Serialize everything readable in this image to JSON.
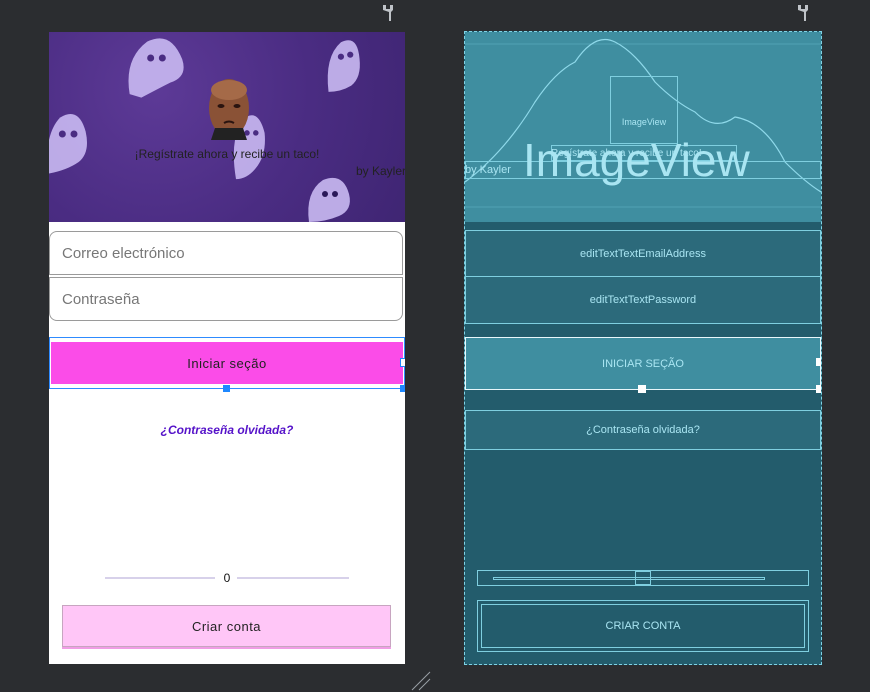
{
  "design": {
    "promo_text": "¡Regístrate ahora y recibe un taco!",
    "byline": "by Kayler",
    "email_placeholder": "Correo electrónico",
    "password_placeholder": "Contraseña",
    "login_label": "Iniciar seção",
    "forgot_label": "¿Contraseña olvidada?",
    "seek_value": "0",
    "create_label": "Criar conta"
  },
  "blueprint": {
    "imageview_small": "ImageView",
    "imageview_big": "ImageView",
    "promo_text": "Regístrate ahora y recibe un taco!",
    "byline": "by Kayler",
    "email_id": "editTextTextEmailAddress",
    "password_id": "editTextTextPassword",
    "login_label": "INICIAR SEÇÃO",
    "forgot_label": "¿Contraseña olvidada?",
    "create_label": "CRIAR CONTA"
  },
  "colors": {
    "canvas": "#2b2d30",
    "hero_purple": "#4a2c82",
    "login_pink": "#fb4ce8",
    "create_pink": "#ffc6f7",
    "link_purple": "#5512c9",
    "blueprint_bg": "#235c6c",
    "blueprint_line": "#7fcfe0"
  },
  "icons": [
    "wrench-icon",
    "wrench-icon",
    "resize-corner-icon",
    "ghost-icon",
    "profile-photo"
  ]
}
